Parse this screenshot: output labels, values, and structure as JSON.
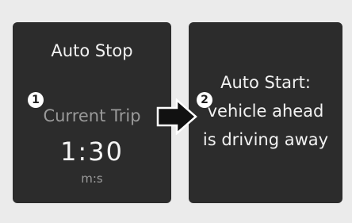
{
  "left_panel": {
    "title": "Auto Stop",
    "callout_number": "1",
    "trip_label": "Current Trip",
    "time_value": "1:30",
    "time_unit": "m:s"
  },
  "right_panel": {
    "callout_number": "2",
    "message_line1": "Auto Start:",
    "message_line2": "vehicle ahead",
    "message_line3": "is driving away"
  },
  "icons": {
    "transition_arrow": "arrow-right-icon"
  },
  "colors": {
    "panel_background": "#2c2c2c",
    "page_background": "#ebebeb",
    "primary_text": "#f2f2f2",
    "secondary_text": "#9a9a9a"
  }
}
